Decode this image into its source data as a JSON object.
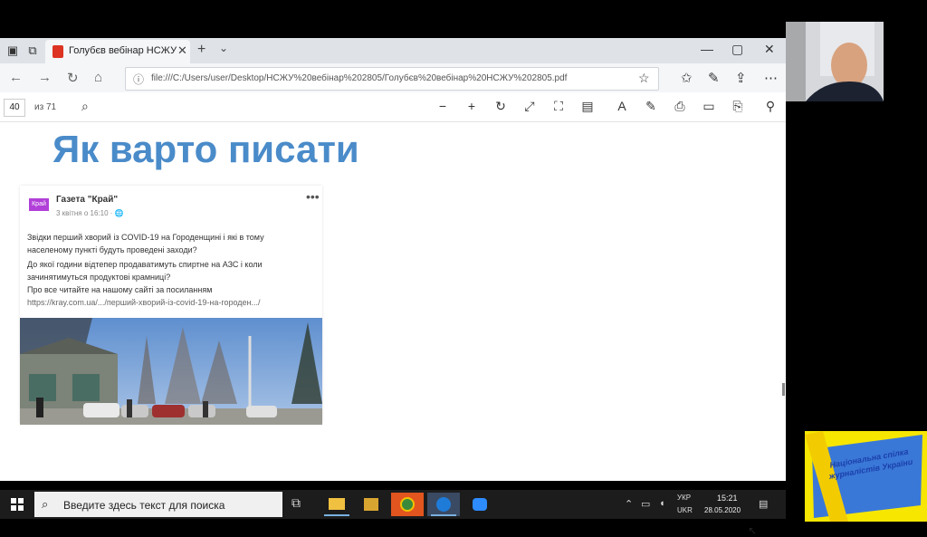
{
  "browser": {
    "tab_title": "Голубєв вебінар НСЖУ",
    "address": "file:///C:/Users/user/Desktop/НСЖУ%20вебінар%202805/Голубєв%20вебінар%20НСЖУ%202805.pdf",
    "tab_close": "✕",
    "new_tab": "+"
  },
  "pdf_toolbar": {
    "page": "40",
    "page_of": "из 71"
  },
  "slide": {
    "title": "Як варто писати"
  },
  "post": {
    "avatar_text": "Край",
    "author": "Газета \"Край\"",
    "date": "3 квітня о 16:10 · ",
    "more": "•••",
    "lines": [
      "Звідки перший хворий із COVID-19 на Городенщині і які в тому",
      "населеному пункті будуть проведені заходи?",
      "До якої години відтепер продаватимуть спиртне на АЗС і коли",
      "зачинятимуться продуктові крамниці?",
      "Про все читайте на нашому сайті за посиланням"
    ],
    "link": "https://kray.com.ua/.../перший-хворий-із-covid-19-на-городен.../"
  },
  "taskbar": {
    "search_placeholder": "Введите здесь текст для поиска",
    "lang_top": "УКР",
    "lang_bottom": "UKR",
    "time": "15:21",
    "date": "28.05.2020"
  },
  "logo": {
    "text": "Національна спілка журналістів України"
  },
  "colors": {
    "title_blue": "#4a8bc9",
    "taskbar": "#1c1c1c",
    "logo_yellow": "#f7e600"
  }
}
